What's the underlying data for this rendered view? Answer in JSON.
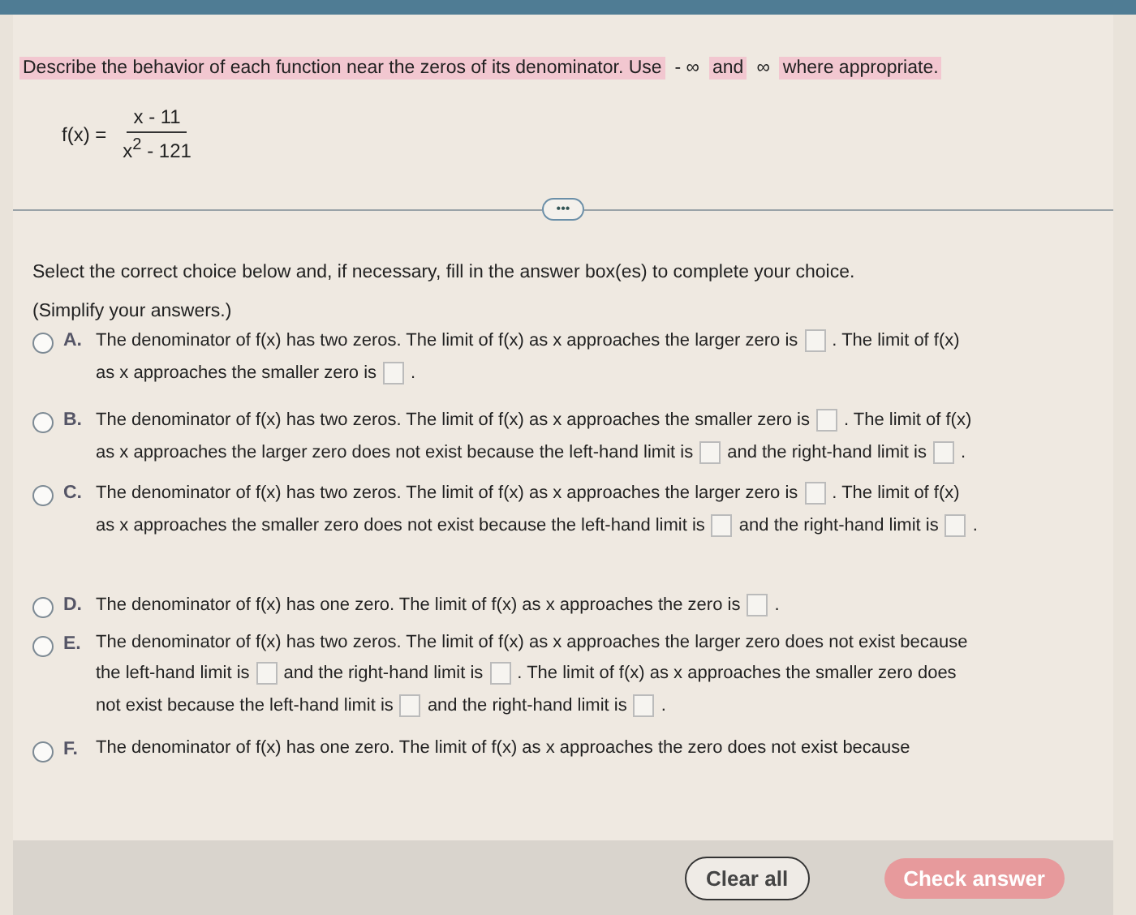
{
  "instruction": [
    {
      "text": "Describe the behavior of each function near the zeros of its denominator. Use",
      "highlight": true
    },
    {
      "text": "- ∞",
      "highlight": false
    },
    {
      "text": "and",
      "highlight": true
    },
    {
      "text": "∞",
      "highlight": false
    },
    {
      "text": "where appropriate.",
      "highlight": true
    }
  ],
  "formula": {
    "lhs": "f(x) =",
    "numerator": "x - 11",
    "denominator": "x$^{2}$ - 121"
  },
  "more_button": "•••",
  "prompt": "Select the correct choice below and, if necessary, fill in the answer box(es) to complete your choice.",
  "note": "(Simplify your answers.)",
  "choices": [
    {
      "letter": "A.",
      "selected": false,
      "lines": [
        [
          {
            "kind": "text",
            "text": "The denominator of f(x) has two zeros. The limit of f(x) as x approaches the larger zero is"
          },
          {
            "kind": "blank"
          },
          {
            "kind": "text",
            "text": ". The limit of f(x)"
          }
        ],
        [
          {
            "kind": "text",
            "text": "as x approaches the smaller zero is"
          },
          {
            "kind": "blank"
          },
          {
            "kind": "text",
            "text": "."
          }
        ]
      ]
    },
    {
      "letter": "B.",
      "selected": false,
      "lines": [
        [
          {
            "kind": "text",
            "text": "The denominator of f(x) has two zeros. The limit of f(x) as x approaches the smaller zero is"
          },
          {
            "kind": "blank"
          },
          {
            "kind": "text",
            "text": ". The limit of f(x)"
          }
        ],
        [
          {
            "kind": "text",
            "text": "as x approaches the larger zero does not exist because the left-hand limit is"
          },
          {
            "kind": "blank"
          },
          {
            "kind": "text",
            "text": "and the right-hand limit is"
          },
          {
            "kind": "blank"
          },
          {
            "kind": "text",
            "text": "."
          }
        ]
      ]
    },
    {
      "letter": "C.",
      "selected": false,
      "lines": [
        [
          {
            "kind": "text",
            "text": "The denominator of f(x) has two zeros. The limit of f(x) as x approaches the larger zero is"
          },
          {
            "kind": "blank"
          },
          {
            "kind": "text",
            "text": ". The limit of f(x)"
          }
        ],
        [
          {
            "kind": "text",
            "text": "as x approaches the smaller zero does not exist because the left-hand limit is"
          },
          {
            "kind": "blank"
          },
          {
            "kind": "text",
            "text": "and the right-hand limit is"
          },
          {
            "kind": "blank"
          },
          {
            "kind": "text",
            "text": "."
          }
        ]
      ]
    },
    {
      "letter": "D.",
      "selected": false,
      "lines": [
        [
          {
            "kind": "text",
            "text": "The denominator of f(x) has one zero. The limit of f(x) as x approaches the zero is"
          },
          {
            "kind": "blank"
          },
          {
            "kind": "text",
            "text": "."
          }
        ]
      ]
    },
    {
      "letter": "E.",
      "selected": false,
      "lines": [
        [
          {
            "kind": "text",
            "text": "The denominator of f(x) has two zeros. The limit of f(x) as x approaches the larger zero does not exist because"
          }
        ],
        [
          {
            "kind": "text",
            "text": "the left-hand limit is"
          },
          {
            "kind": "blank"
          },
          {
            "kind": "text",
            "text": "and the right-hand limit is"
          },
          {
            "kind": "blank"
          },
          {
            "kind": "text",
            "text": ". The limit of f(x) as x approaches the smaller zero does"
          }
        ],
        [
          {
            "kind": "text",
            "text": "not exist because the left-hand limit is"
          },
          {
            "kind": "blank"
          },
          {
            "kind": "text",
            "text": "and the right-hand limit is"
          },
          {
            "kind": "blank"
          },
          {
            "kind": "text",
            "text": "."
          }
        ]
      ]
    },
    {
      "letter": "F.",
      "selected": false,
      "lines": [
        [
          {
            "kind": "text",
            "text": "The denominator of f(x) has one zero. The limit of f(x) as x approaches the zero does not exist because"
          }
        ]
      ]
    }
  ],
  "buttons": [
    {
      "label": "Clear all",
      "kind": "secondary"
    },
    {
      "label": "Check answer",
      "kind": "primary"
    }
  ]
}
